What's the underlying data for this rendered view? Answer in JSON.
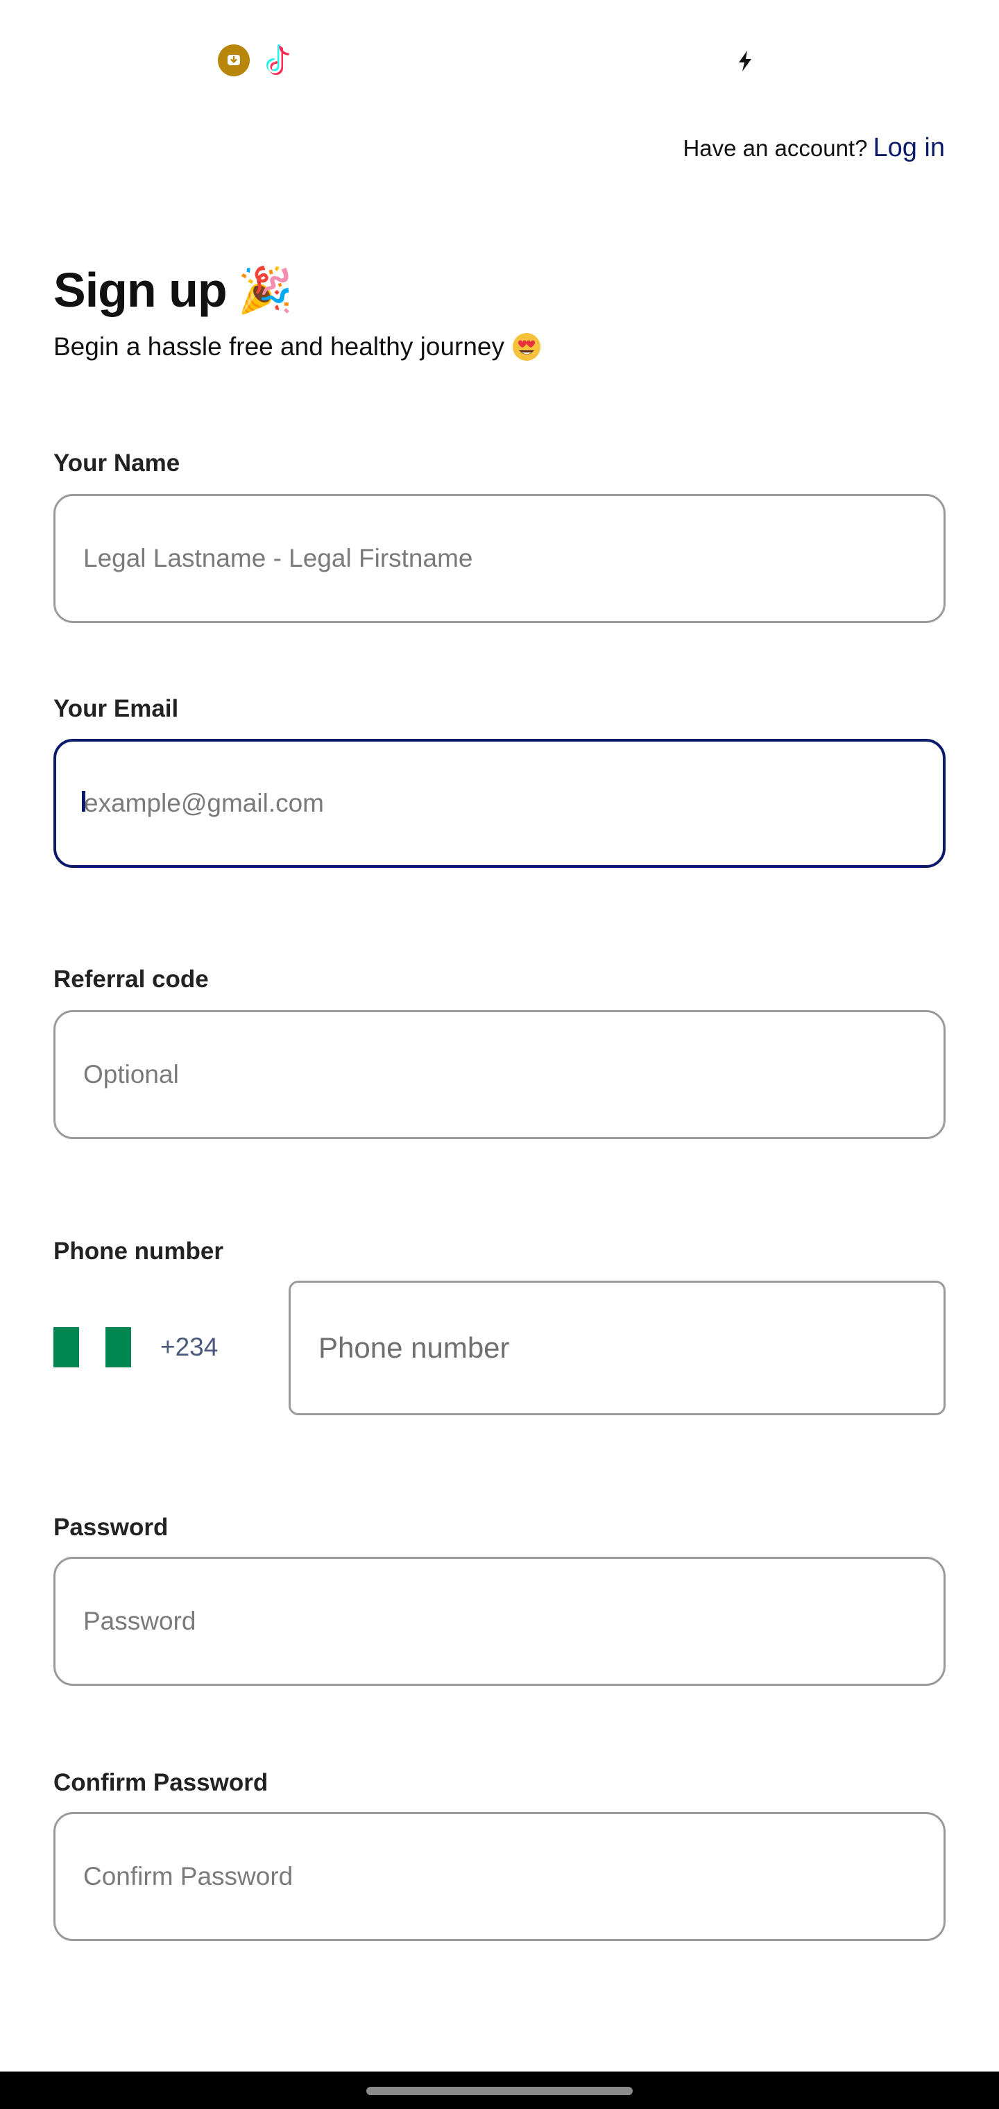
{
  "status_bar": {
    "icons": [
      "download-icon",
      "tiktok-icon",
      "bolt-icon"
    ]
  },
  "header": {
    "have_account_text": "Have an account?",
    "login_label": "Log in"
  },
  "page": {
    "title": "Sign up",
    "title_emoji": "🎉",
    "subtitle": "Begin a hassle free and healthy journey"
  },
  "form": {
    "name": {
      "label": "Your Name",
      "placeholder": "Legal Lastname - Legal Firstname",
      "value": ""
    },
    "email": {
      "label": "Your Email",
      "placeholder": "example@gmail.com",
      "value": "",
      "focused": true
    },
    "referral": {
      "label": "Referral code",
      "placeholder": "Optional",
      "value": ""
    },
    "phone": {
      "label": "Phone number",
      "country_flag": "nigeria-flag-icon",
      "dial_code": "+234",
      "placeholder": "Phone number",
      "value": ""
    },
    "password": {
      "label": "Password",
      "placeholder": "Password",
      "value": ""
    },
    "confirm_password": {
      "label": "Confirm Password",
      "placeholder": "Confirm Password",
      "value": ""
    }
  },
  "colors": {
    "accent": "#0b1a6b",
    "input_border": "#9a9a9a",
    "flag_green": "#008751",
    "status_download_icon": "#b8860b"
  }
}
